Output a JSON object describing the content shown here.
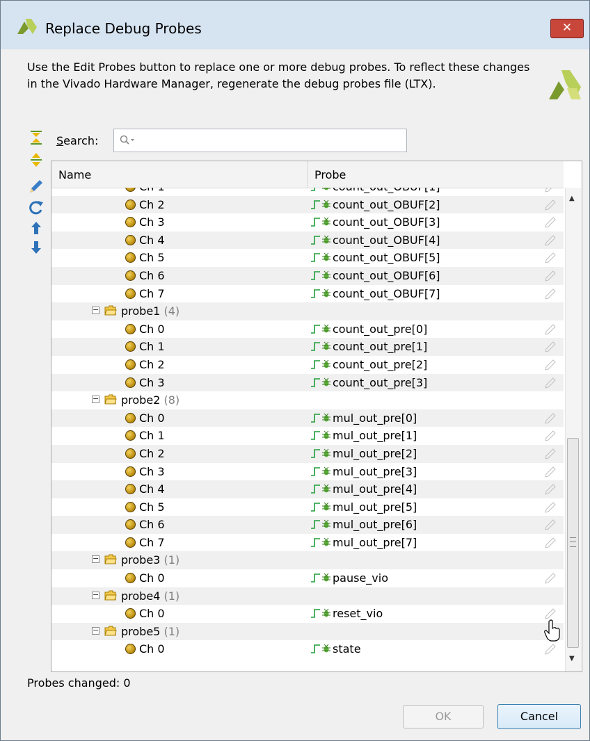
{
  "window": {
    "title": "Replace Debug Probes",
    "close_icon": "close-icon",
    "description": "Use the Edit Probes button to replace one or more debug probes. To reflect these changes in the Vivado Hardware Manager, regenerate the debug probes file (LTX)."
  },
  "toolbar": {
    "icons": [
      "collapse-all-icon",
      "expand-all-icon",
      "edit-pencil-icon",
      "refresh-icon",
      "move-up-icon",
      "move-down-icon"
    ]
  },
  "search": {
    "label_first": "S",
    "label_rest": "earch:",
    "value": ""
  },
  "table": {
    "columns": [
      "Name",
      "Probe"
    ],
    "rows": [
      {
        "type": "chan",
        "name": "Ch 1",
        "probe": "count_out_OBUF[1]",
        "level": 2
      },
      {
        "type": "chan",
        "name": "Ch 2",
        "probe": "count_out_OBUF[2]",
        "level": 2
      },
      {
        "type": "chan",
        "name": "Ch 3",
        "probe": "count_out_OBUF[3]",
        "level": 2
      },
      {
        "type": "chan",
        "name": "Ch 4",
        "probe": "count_out_OBUF[4]",
        "level": 2
      },
      {
        "type": "chan",
        "name": "Ch 5",
        "probe": "count_out_OBUF[5]",
        "level": 2
      },
      {
        "type": "chan",
        "name": "Ch 6",
        "probe": "count_out_OBUF[6]",
        "level": 2
      },
      {
        "type": "chan",
        "name": "Ch 7",
        "probe": "count_out_OBUF[7]",
        "level": 2
      },
      {
        "type": "group",
        "name": "probe1",
        "count": "(4)",
        "level": 1
      },
      {
        "type": "chan",
        "name": "Ch 0",
        "probe": "count_out_pre[0]",
        "level": 2
      },
      {
        "type": "chan",
        "name": "Ch 1",
        "probe": "count_out_pre[1]",
        "level": 2
      },
      {
        "type": "chan",
        "name": "Ch 2",
        "probe": "count_out_pre[2]",
        "level": 2
      },
      {
        "type": "chan",
        "name": "Ch 3",
        "probe": "count_out_pre[3]",
        "level": 2
      },
      {
        "type": "group",
        "name": "probe2",
        "count": "(8)",
        "level": 1
      },
      {
        "type": "chan",
        "name": "Ch 0",
        "probe": "mul_out_pre[0]",
        "level": 2
      },
      {
        "type": "chan",
        "name": "Ch 1",
        "probe": "mul_out_pre[1]",
        "level": 2
      },
      {
        "type": "chan",
        "name": "Ch 2",
        "probe": "mul_out_pre[2]",
        "level": 2
      },
      {
        "type": "chan",
        "name": "Ch 3",
        "probe": "mul_out_pre[3]",
        "level": 2
      },
      {
        "type": "chan",
        "name": "Ch 4",
        "probe": "mul_out_pre[4]",
        "level": 2
      },
      {
        "type": "chan",
        "name": "Ch 5",
        "probe": "mul_out_pre[5]",
        "level": 2
      },
      {
        "type": "chan",
        "name": "Ch 6",
        "probe": "mul_out_pre[6]",
        "level": 2
      },
      {
        "type": "chan",
        "name": "Ch 7",
        "probe": "mul_out_pre[7]",
        "level": 2
      },
      {
        "type": "group",
        "name": "probe3",
        "count": "(1)",
        "level": 1
      },
      {
        "type": "chan",
        "name": "Ch 0",
        "probe": "pause_vio",
        "level": 2
      },
      {
        "type": "group",
        "name": "probe4",
        "count": "(1)",
        "level": 1
      },
      {
        "type": "chan",
        "name": "Ch 0",
        "probe": "reset_vio",
        "level": 2
      },
      {
        "type": "group",
        "name": "probe5",
        "count": "(1)",
        "level": 1
      },
      {
        "type": "chan",
        "name": "Ch 0",
        "probe": "state",
        "level": 2
      }
    ]
  },
  "status": {
    "probes_changed": "Probes changed: 0"
  },
  "buttons": {
    "ok": "OK",
    "cancel": "Cancel"
  },
  "colors": {
    "xilinx_logo": "#7b9a2e",
    "wave_green": "#1f9d3a",
    "title_bar": "#d6e3f1",
    "close_red": "#c8473a"
  }
}
